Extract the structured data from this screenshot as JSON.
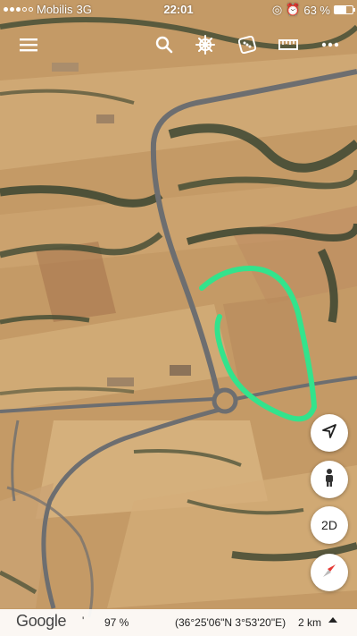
{
  "status": {
    "carrier": "Mobilis",
    "network": "3G",
    "time": "22:01",
    "battery": "63 %",
    "battery_level": 0.63
  },
  "toolbar": {
    "menu": "menu-icon",
    "search": "search-icon",
    "voyager": "ships-wheel-icon",
    "feeling_lucky": "dice-icon",
    "measure": "ruler-icon",
    "more": "more-icon"
  },
  "controls": {
    "my_location": "location-arrow-icon",
    "street_view": "pegman-icon",
    "view_mode": "2D",
    "compass": "compass-icon"
  },
  "footer": {
    "logo": "Google",
    "tilt_mark": "'",
    "zoom": "97 %",
    "coordinates": "(36°25'06\"N 3°53'20\"E)",
    "scale": "2 km"
  },
  "colors": {
    "field": "#c9a06b",
    "field_light": "#d8b480",
    "road": "#6d6e70",
    "vegetation": "#3f4a33",
    "annotation": "#33e38c"
  }
}
